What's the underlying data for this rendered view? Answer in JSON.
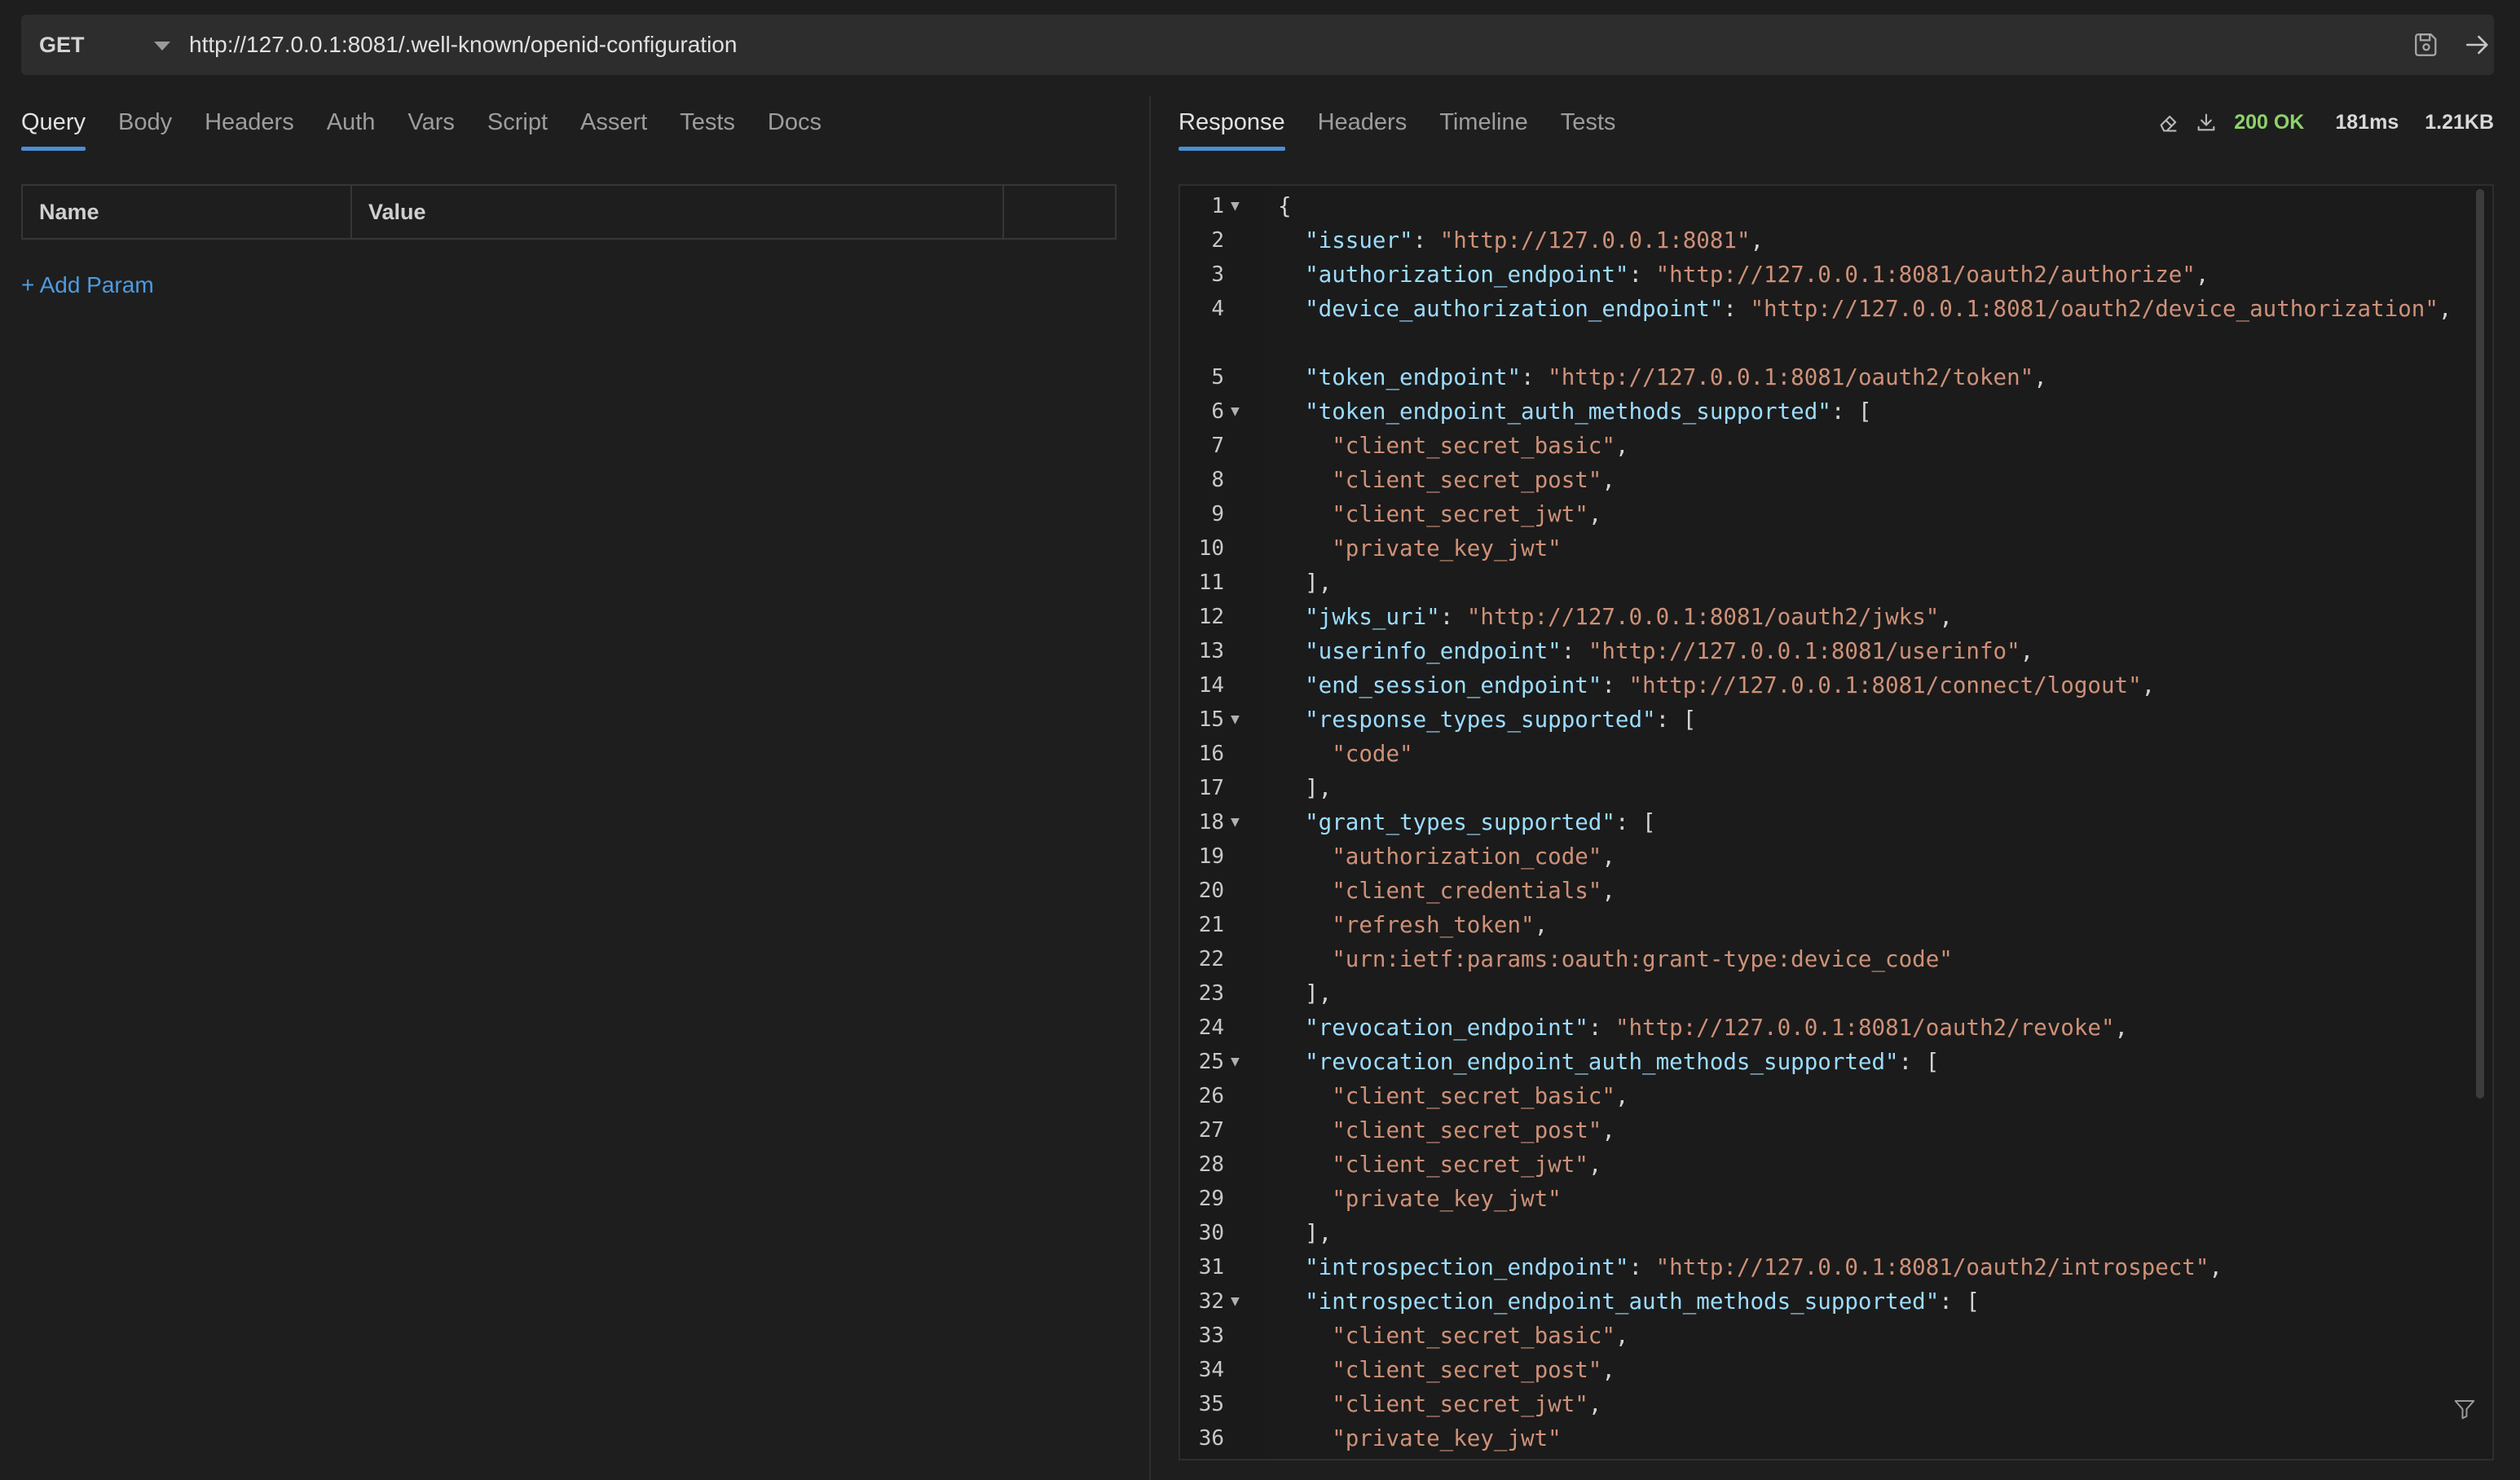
{
  "request": {
    "method": "GET",
    "url": "http://127.0.0.1:8081/.well-known/openid-configuration"
  },
  "icons": {
    "method_caret": "chevron-down-icon",
    "save": "save-icon",
    "send": "arrow-right-icon",
    "clear": "eraser-icon",
    "download": "download-icon",
    "filter": "filter-icon"
  },
  "left_tabs": [
    "Query",
    "Body",
    "Headers",
    "Auth",
    "Vars",
    "Script",
    "Assert",
    "Tests",
    "Docs"
  ],
  "active_left_tab": "Query",
  "params_table": {
    "headers": [
      "Name",
      "Value",
      ""
    ],
    "add_label": "+ Add Param"
  },
  "right_tabs": [
    "Response",
    "Headers",
    "Timeline",
    "Tests"
  ],
  "active_right_tab": "Response",
  "status": {
    "code": "200 OK",
    "time": "181ms",
    "size": "1.21KB"
  },
  "colors": {
    "accent": "#4a8fd6",
    "status_ok": "#8fd16b",
    "json_key": "#9cdcfe",
    "json_string": "#ce9178"
  },
  "response_lines": [
    {
      "n": "1",
      "fold": true,
      "text": "{"
    },
    {
      "n": "2",
      "fold": false,
      "text": "  \"issuer\": \"http://127.0.0.1:8081\","
    },
    {
      "n": "3",
      "fold": false,
      "text": "  \"authorization_endpoint\": \"http://127.0.0.1:8081/oauth2/authorize\","
    },
    {
      "n": "4",
      "fold": false,
      "wrap": true,
      "text": "  \"device_authorization_endpoint\": \"http://127.0.0.1:8081/oauth2/device_authorization\","
    },
    {
      "n": "5",
      "fold": false,
      "text": "  \"token_endpoint\": \"http://127.0.0.1:8081/oauth2/token\","
    },
    {
      "n": "6",
      "fold": true,
      "text": "  \"token_endpoint_auth_methods_supported\": ["
    },
    {
      "n": "7",
      "fold": false,
      "text": "    \"client_secret_basic\","
    },
    {
      "n": "8",
      "fold": false,
      "text": "    \"client_secret_post\","
    },
    {
      "n": "9",
      "fold": false,
      "text": "    \"client_secret_jwt\","
    },
    {
      "n": "10",
      "fold": false,
      "text": "    \"private_key_jwt\""
    },
    {
      "n": "11",
      "fold": false,
      "text": "  ],"
    },
    {
      "n": "12",
      "fold": false,
      "text": "  \"jwks_uri\": \"http://127.0.0.1:8081/oauth2/jwks\","
    },
    {
      "n": "13",
      "fold": false,
      "text": "  \"userinfo_endpoint\": \"http://127.0.0.1:8081/userinfo\","
    },
    {
      "n": "14",
      "fold": false,
      "text": "  \"end_session_endpoint\": \"http://127.0.0.1:8081/connect/logout\","
    },
    {
      "n": "15",
      "fold": true,
      "text": "  \"response_types_supported\": ["
    },
    {
      "n": "16",
      "fold": false,
      "text": "    \"code\""
    },
    {
      "n": "17",
      "fold": false,
      "text": "  ],"
    },
    {
      "n": "18",
      "fold": true,
      "text": "  \"grant_types_supported\": ["
    },
    {
      "n": "19",
      "fold": false,
      "text": "    \"authorization_code\","
    },
    {
      "n": "20",
      "fold": false,
      "text": "    \"client_credentials\","
    },
    {
      "n": "21",
      "fold": false,
      "text": "    \"refresh_token\","
    },
    {
      "n": "22",
      "fold": false,
      "text": "    \"urn:ietf:params:oauth:grant-type:device_code\""
    },
    {
      "n": "23",
      "fold": false,
      "text": "  ],"
    },
    {
      "n": "24",
      "fold": false,
      "text": "  \"revocation_endpoint\": \"http://127.0.0.1:8081/oauth2/revoke\","
    },
    {
      "n": "25",
      "fold": true,
      "text": "  \"revocation_endpoint_auth_methods_supported\": ["
    },
    {
      "n": "26",
      "fold": false,
      "text": "    \"client_secret_basic\","
    },
    {
      "n": "27",
      "fold": false,
      "text": "    \"client_secret_post\","
    },
    {
      "n": "28",
      "fold": false,
      "text": "    \"client_secret_jwt\","
    },
    {
      "n": "29",
      "fold": false,
      "text": "    \"private_key_jwt\""
    },
    {
      "n": "30",
      "fold": false,
      "text": "  ],"
    },
    {
      "n": "31",
      "fold": false,
      "text": "  \"introspection_endpoint\": \"http://127.0.0.1:8081/oauth2/introspect\","
    },
    {
      "n": "32",
      "fold": true,
      "text": "  \"introspection_endpoint_auth_methods_supported\": ["
    },
    {
      "n": "33",
      "fold": false,
      "text": "    \"client_secret_basic\","
    },
    {
      "n": "34",
      "fold": false,
      "text": "    \"client_secret_post\","
    },
    {
      "n": "35",
      "fold": false,
      "text": "    \"client_secret_jwt\","
    },
    {
      "n": "36",
      "fold": false,
      "text": "    \"private_key_jwt\""
    }
  ]
}
